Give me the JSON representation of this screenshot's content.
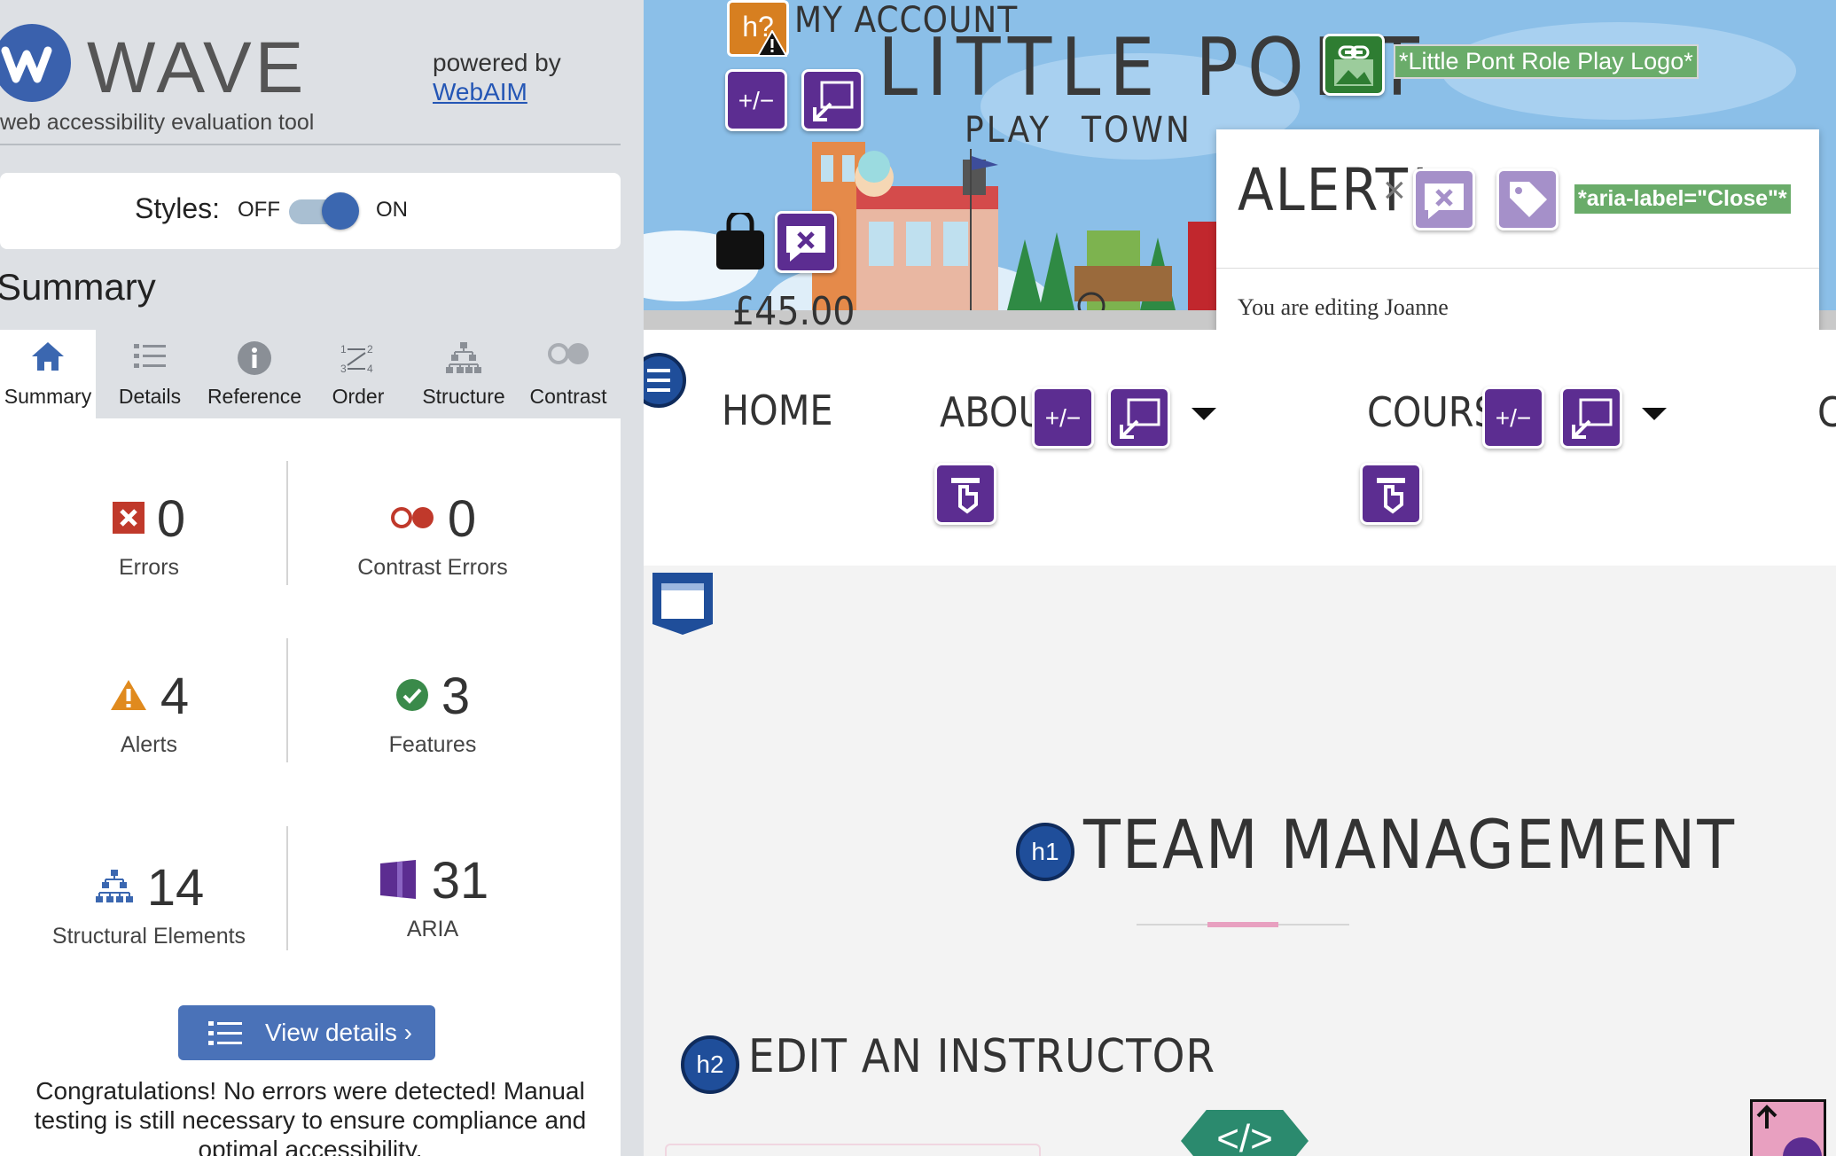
{
  "wave": {
    "title": "WAVE",
    "subtitle": "web accessibility evaluation tool",
    "powered_by": "powered by",
    "webaim_link": "WebAIM",
    "styles": {
      "label": "Styles:",
      "off": "OFF",
      "on": "ON",
      "state": "on"
    },
    "summary_heading": "Summary",
    "tabs": [
      {
        "label": "Summary",
        "icon": "home-icon",
        "active": true
      },
      {
        "label": "Details",
        "icon": "list-icon",
        "active": false
      },
      {
        "label": "Reference",
        "icon": "info-icon",
        "active": false
      },
      {
        "label": "Order",
        "icon": "order-icon",
        "active": false
      },
      {
        "label": "Structure",
        "icon": "structure-icon",
        "active": false
      },
      {
        "label": "Contrast",
        "icon": "contrast-icon",
        "active": false
      }
    ],
    "stats": {
      "errors": {
        "value": "0",
        "label": "Errors",
        "color": "#c0392b"
      },
      "contrast_errors": {
        "value": "0",
        "label": "Contrast Errors",
        "color": "#c0392b"
      },
      "alerts": {
        "value": "4",
        "label": "Alerts",
        "color": "#e08a1e"
      },
      "features": {
        "value": "3",
        "label": "Features",
        "color": "#3a8a4a"
      },
      "structural": {
        "value": "14",
        "label": "Structural Elements",
        "color": "#3b67b0"
      },
      "aria": {
        "value": "31",
        "label": "ARIA",
        "color": "#5c2d91"
      }
    },
    "view_details": "View details ›",
    "congrats": "Congratulations! No errors were detected! Manual testing is still necessary to ensure compliance and optimal accessibility."
  },
  "site": {
    "my_account": "My Account",
    "brand_line1": "Little Pont",
    "brand_word_play": "Play",
    "brand_word_town": "Town",
    "price": "£45.00",
    "logo_alt": "*Little Pont Role Play Logo*",
    "nav": {
      "home": "Home",
      "about": "About",
      "courses": "Courses",
      "cut": "C"
    },
    "alert": {
      "title": "Alert!",
      "close": "×",
      "aria_label": "*aria-label=\"Close\"*",
      "message": "You are editing Joanne"
    },
    "h1": "Team Management",
    "h1_badge": "h1",
    "h2": "Edit an Instructor",
    "h2_badge": "h2",
    "h_question": "h?",
    "code_badge": "</>",
    "plus_minus": "+/−"
  },
  "colors": {
    "wave_blue": "#3b67b0",
    "aria_purple": "#5c2d91",
    "accent_pink": "#e8a0c0",
    "alt_green": "#6aac6a",
    "sky": "#8bbfe8"
  }
}
